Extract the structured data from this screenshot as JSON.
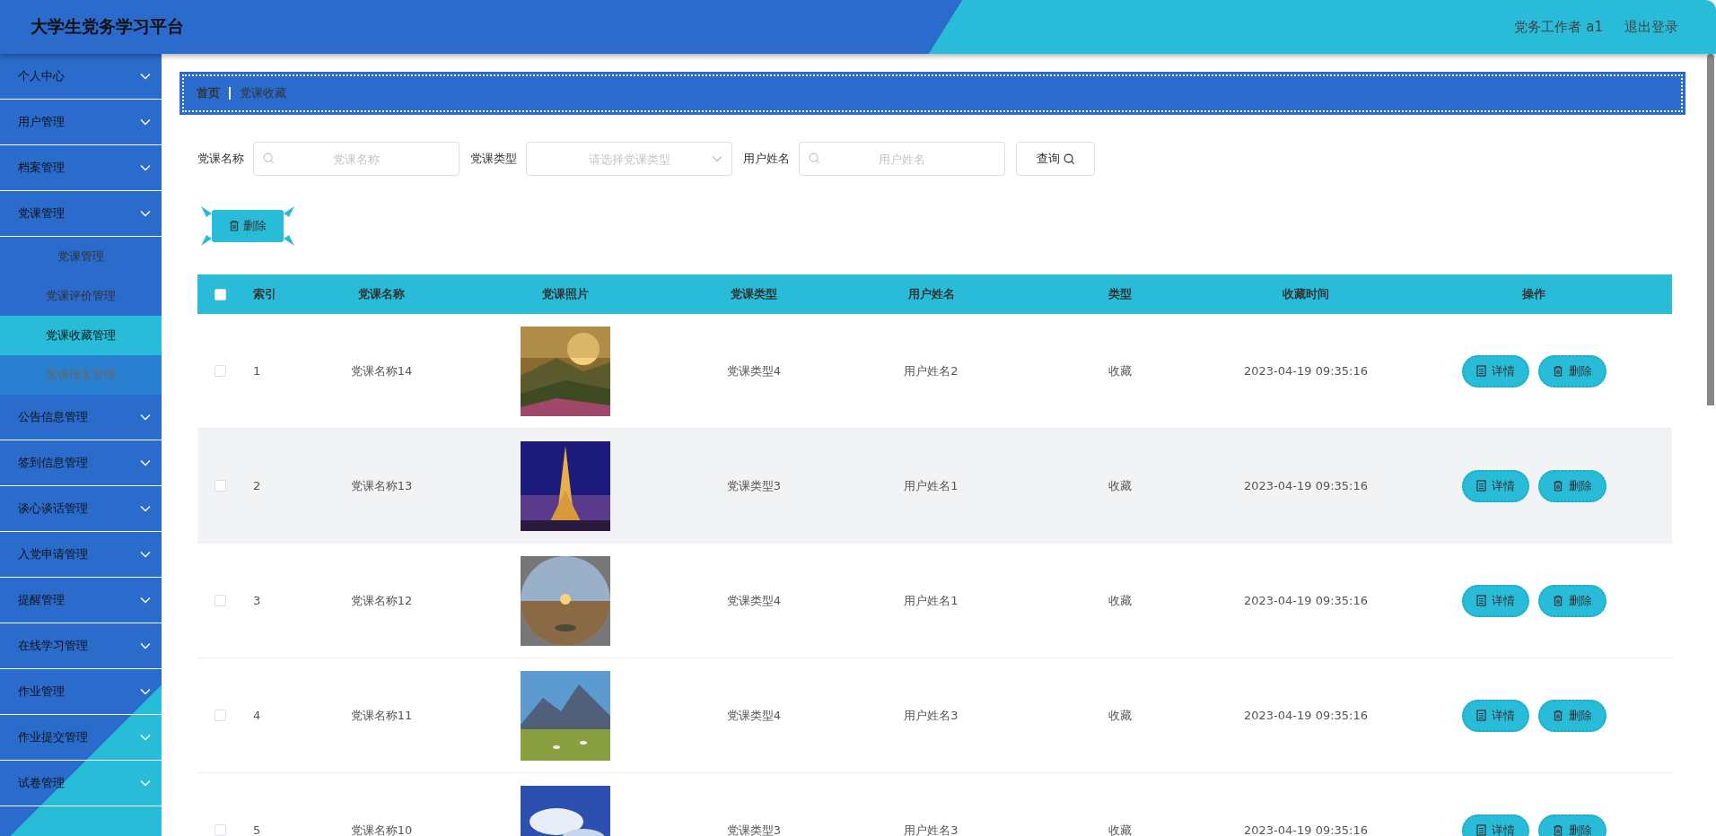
{
  "header": {
    "title": "大学生党务学习平台",
    "user": "党务工作者 a1",
    "logout": "退出登录"
  },
  "sidebar": {
    "items": [
      {
        "label": "个人中心"
      },
      {
        "label": "用户管理"
      },
      {
        "label": "档案管理"
      },
      {
        "label": "党课管理",
        "children": [
          {
            "label": "党课管理",
            "selected": false,
            "hovered": false
          },
          {
            "label": "党课评价管理",
            "selected": false,
            "hovered": false
          },
          {
            "label": "党课收藏管理",
            "selected": true,
            "hovered": false
          },
          {
            "label": "党课报名管理",
            "selected": false,
            "hovered": true
          }
        ]
      },
      {
        "label": "公告信息管理"
      },
      {
        "label": "签到信息管理"
      },
      {
        "label": "谈心谈话管理"
      },
      {
        "label": "入党申请管理"
      },
      {
        "label": "提醒管理"
      },
      {
        "label": "在线学习管理"
      },
      {
        "label": "作业管理"
      },
      {
        "label": "作业提交管理"
      },
      {
        "label": "试卷管理"
      }
    ]
  },
  "breadcrumb": [
    "首页",
    "党课收藏"
  ],
  "filters": [
    {
      "kind": "search",
      "label": "党课名称",
      "placeholder": "党课名称"
    },
    {
      "kind": "select",
      "label": "党课类型",
      "placeholder": "请选择党课类型"
    },
    {
      "kind": "search",
      "label": "用户姓名",
      "placeholder": "用户姓名"
    }
  ],
  "query_button": "查询",
  "delete_button": "删除",
  "table": {
    "all_checked": false,
    "columns": [
      "索引",
      "党课名称",
      "党课照片",
      "党课类型",
      "用户姓名",
      "类型",
      "收藏时间",
      "操作"
    ],
    "rows": [
      {
        "checked": false,
        "highlighted": false,
        "index": "1",
        "name": "党课名称14",
        "course_type": "党课类型4",
        "user": "用户姓名2",
        "type": "收藏",
        "time": "2023-04-19 09:35:16",
        "actions": [
          "详情",
          "删除"
        ]
      },
      {
        "checked": false,
        "highlighted": true,
        "index": "2",
        "name": "党课名称13",
        "course_type": "党课类型3",
        "user": "用户姓名1",
        "type": "收藏",
        "time": "2023-04-19 09:35:16",
        "actions": [
          "详情",
          "删除"
        ]
      },
      {
        "checked": false,
        "highlighted": false,
        "index": "3",
        "name": "党课名称12",
        "course_type": "党课类型4",
        "user": "用户姓名1",
        "type": "收藏",
        "time": "2023-04-19 09:35:16",
        "actions": [
          "详情",
          "删除"
        ]
      },
      {
        "checked": false,
        "highlighted": false,
        "index": "4",
        "name": "党课名称11",
        "course_type": "党课类型4",
        "user": "用户姓名3",
        "type": "收藏",
        "time": "2023-04-19 09:35:16",
        "actions": [
          "详情",
          "删除"
        ]
      },
      {
        "checked": false,
        "highlighted": false,
        "index": "5",
        "name": "党课名称10",
        "course_type": "党课类型3",
        "user": "用户姓名3",
        "type": "收藏",
        "time": "2023-04-19 09:35:16",
        "actions": [
          "详情",
          "删除"
        ]
      }
    ]
  }
}
